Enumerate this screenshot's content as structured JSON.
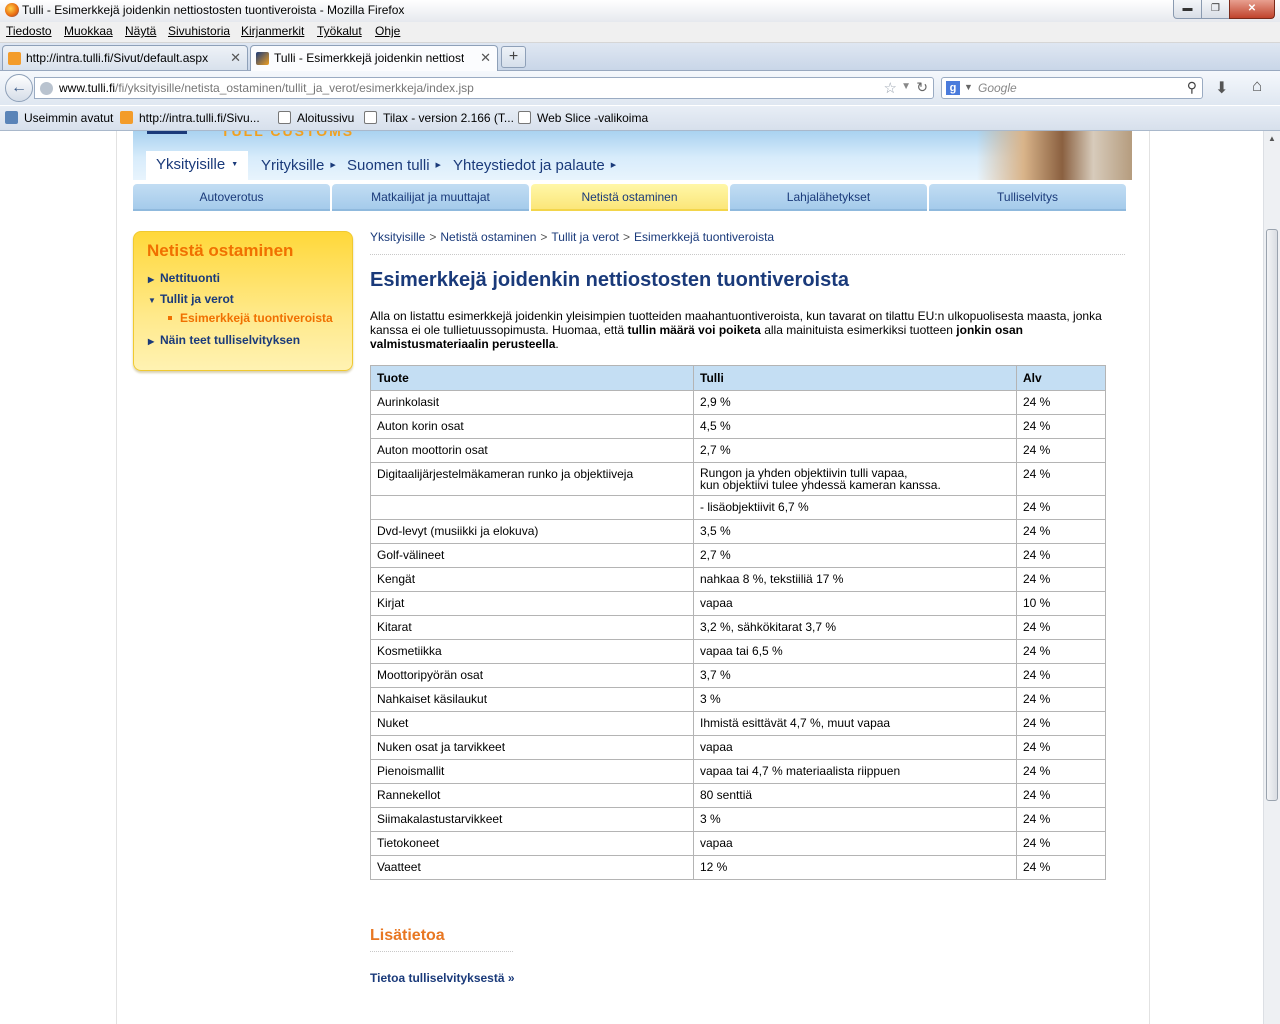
{
  "window": {
    "title": "Tulli - Esimerkkejä joidenkin nettiostosten tuontiveroista - Mozilla Firefox",
    "buttons": {
      "minimize": "▬",
      "maximize": "❐",
      "close": "✕"
    }
  },
  "menu": [
    "Tiedosto",
    "Muokkaa",
    "Näytä",
    "Sivuhistoria",
    "Kirjanmerkit",
    "Työkalut",
    "Ohje"
  ],
  "tabs": [
    {
      "label": "http://intra.tulli.fi/Sivut/default.aspx",
      "close": "✕"
    },
    {
      "label": "Tulli - Esimerkkejä joidenkin nettiosto...",
      "close": "✕"
    }
  ],
  "newtab": "+",
  "navbar": {
    "url_domain": "www.tulli.fi",
    "url_path": "/fi/yksityisille/netista_ostaminen/tullit_ja_verot/esimerkkeja/index.jsp",
    "search_placeholder": "Google",
    "search_engine_icon": "g"
  },
  "bookmarks": [
    "Useimmin avatut",
    "http://intra.tulli.fi/Sivu...",
    "Aloitussivu",
    "Tilax - version 2.166 (T...",
    "Web Slice -valikoima"
  ],
  "site": {
    "logo_text": "TULL CUSTOMS",
    "main_nav": [
      {
        "label": "Yksityisille"
      },
      {
        "label": "Yrityksille"
      },
      {
        "label": "Suomen tulli"
      },
      {
        "label": "Yhteystiedot ja palaute"
      }
    ],
    "sub_nav": [
      "Autoverotus",
      "Matkailijat ja muuttajat",
      "Netistä ostaminen",
      "Lahjalähetykset",
      "Tulliselvitys"
    ],
    "sidebar": {
      "title": "Netistä ostaminen",
      "items": [
        "Nettituonti",
        "Tullit ja verot",
        "Näin teet tulliselvityksen"
      ],
      "sub_item": "Esimerkkejä tuontiveroista"
    },
    "breadcrumb": [
      "Yksityisille",
      "Netistä ostaminen",
      "Tullit ja verot",
      "Esimerkkejä tuontiveroista"
    ],
    "page_title": "Esimerkkejä joidenkin nettiostosten tuontiveroista",
    "intro": {
      "p1": "Alla on listattu esimerkkejä joidenkin yleisimpien tuotteiden maahantuontiveroista, kun tavarat on tilattu EU:n ulkopuolisesta maasta, jonka kanssa ei ole tullietuussopimusta. Huomaa, että ",
      "b1": "tullin määrä voi poiketa",
      "p2": " alla mainituista esimerkiksi tuotteen ",
      "b2": "jonkin osan valmistusmateriaalin perusteella",
      "p3": "."
    },
    "table": {
      "headers": [
        "Tuote",
        "Tulli",
        "Alv"
      ],
      "rows": [
        [
          "Aurinkolasit",
          "2,9 %",
          "24 %"
        ],
        [
          "Auton korin osat",
          "4,5 %",
          "24 %"
        ],
        [
          "Auton moottorin osat",
          "2,7 %",
          "24 %"
        ],
        [
          "Digitaalijärjestelmäkameran runko ja objektiiveja",
          "Rungon ja yhden objektiivin tulli vapaa,|kun objektiivi tulee yhdessä kameran kanssa.",
          "24 %"
        ],
        [
          "",
          "-  lisäobjektiivit 6,7 %",
          "24 %"
        ],
        [
          "Dvd-levyt (musiikki ja elokuva)",
          "3,5 %",
          "24 %"
        ],
        [
          "Golf-välineet",
          "2,7 %",
          "24 %"
        ],
        [
          "Kengät",
          "nahkaa 8 %, tekstiiliä 17 %",
          "24 %"
        ],
        [
          "Kirjat",
          "vapaa",
          "10 %"
        ],
        [
          "Kitarat",
          "3,2 %, sähkökitarat 3,7 %",
          "24 %"
        ],
        [
          "Kosmetiikka",
          "vapaa tai 6,5 %",
          "24 %"
        ],
        [
          "Moottoripyörän osat",
          "3,7 %",
          "24 %"
        ],
        [
          "Nahkaiset käsilaukut",
          "3 %",
          "24 %"
        ],
        [
          "Nuket",
          "Ihmistä esittävät 4,7 %, muut vapaa",
          "24 %"
        ],
        [
          "Nuken osat ja tarvikkeet",
          "vapaa",
          "24 %"
        ],
        [
          "Pienoismallit",
          "vapaa tai 4,7 % materiaalista riippuen",
          "24 %"
        ],
        [
          "Rannekellot",
          "80 senttiä",
          "24 %"
        ],
        [
          "Siimakalastustarvikkeet",
          "3 %",
          "24 %"
        ],
        [
          "Tietokoneet",
          "vapaa",
          "24 %"
        ],
        [
          "Vaatteet",
          "12 %",
          "24 %"
        ]
      ]
    },
    "more": {
      "title": "Lisätietoa",
      "link": "Tietoa tulliselvityksestä »"
    }
  }
}
